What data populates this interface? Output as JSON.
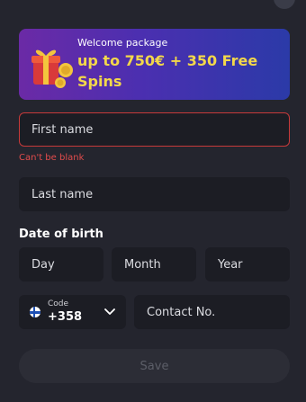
{
  "banner": {
    "subtitle": "Welcome package",
    "title": "up to 750€ + 350 Free Spins"
  },
  "form": {
    "first_name": {
      "placeholder": "First name",
      "value": ""
    },
    "first_name_error": "Can't be blank",
    "last_name": {
      "placeholder": "Last name",
      "value": ""
    },
    "dob_label": "Date of birth",
    "day": {
      "placeholder": "Day"
    },
    "month": {
      "placeholder": "Month"
    },
    "year": {
      "placeholder": "Year"
    },
    "phone_code": {
      "label": "Code",
      "value": "+358",
      "flag": "finland-flag-icon"
    },
    "contact": {
      "placeholder": "Contact No."
    },
    "save_label": "Save"
  },
  "colors": {
    "background": "#24252e",
    "field": "#1c1d24",
    "error": "#e24c4c",
    "banner_title": "#f3d84a"
  }
}
